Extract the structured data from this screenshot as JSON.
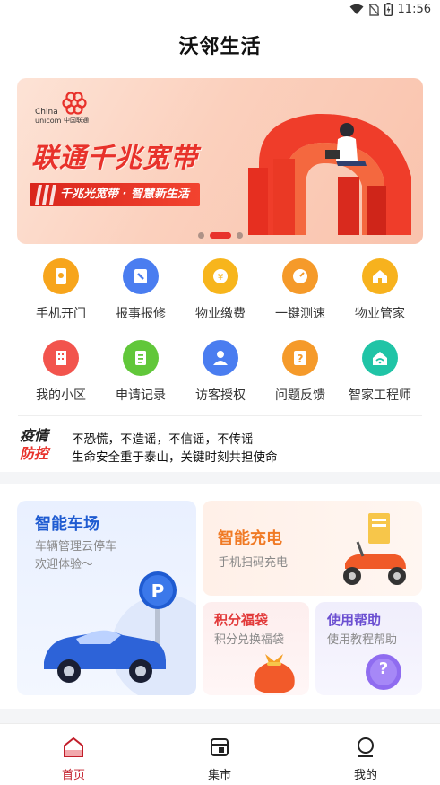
{
  "status_bar": {
    "time": "11:56"
  },
  "app_title": "沃邻生活",
  "banner": {
    "logo_en_1": "China",
    "logo_en_2": "unicom",
    "logo_cn": "中国联通",
    "headline": "联通千兆宽带",
    "subline": "千兆光宽带 · 智慧新生活",
    "active_slide": 2,
    "slide_count": 3
  },
  "services": [
    {
      "label": "手机开门",
      "icon": "phone-door-icon",
      "color": "#f7a51c"
    },
    {
      "label": "报事报修",
      "icon": "repair-icon",
      "color": "#4a7df0"
    },
    {
      "label": "物业缴费",
      "icon": "payment-icon",
      "color": "#f7b51c"
    },
    {
      "label": "一键测速",
      "icon": "speedometer-icon",
      "color": "#f59a2a"
    },
    {
      "label": "物业管家",
      "icon": "house-icon",
      "color": "#f7b21e"
    },
    {
      "label": "我的小区",
      "icon": "building-icon",
      "color": "#f2544d"
    },
    {
      "label": "申请记录",
      "icon": "document-icon",
      "color": "#61c73a"
    },
    {
      "label": "访客授权",
      "icon": "person-icon",
      "color": "#4a7df0"
    },
    {
      "label": "问题反馈",
      "icon": "question-icon",
      "color": "#f59a2a"
    },
    {
      "label": "智家工程师",
      "icon": "wifi-home-icon",
      "color": "#20c4a6"
    }
  ],
  "notice": {
    "badge_1": "疫情",
    "badge_2": "防控",
    "line_1": "不恐慌，不造谣，不信谣，不传谣",
    "line_2": "生命安全重于泰山，关键时刻共担使命"
  },
  "cards": {
    "parking": {
      "title": "智能车场",
      "sub_1": "车辆管理云停车",
      "sub_2": "欢迎体验～",
      "sign": "P"
    },
    "charging": {
      "title": "智能充电",
      "sub": "手机扫码充电"
    },
    "points": {
      "title": "积分福袋",
      "sub": "积分兑换福袋"
    },
    "help": {
      "title": "使用帮助",
      "sub": "使用教程帮助",
      "badge": "?"
    }
  },
  "tabs": [
    {
      "label": "首页",
      "icon": "home-icon",
      "active": true
    },
    {
      "label": "集市",
      "icon": "market-icon",
      "active": false
    },
    {
      "label": "我的",
      "icon": "profile-icon",
      "active": false
    }
  ],
  "colors": {
    "accent": "#e8322b",
    "parking_blue": "#1f5bd1",
    "charge_orange": "#f07a25",
    "points_red": "#e23a3a",
    "help_purple": "#6b4fd1"
  }
}
